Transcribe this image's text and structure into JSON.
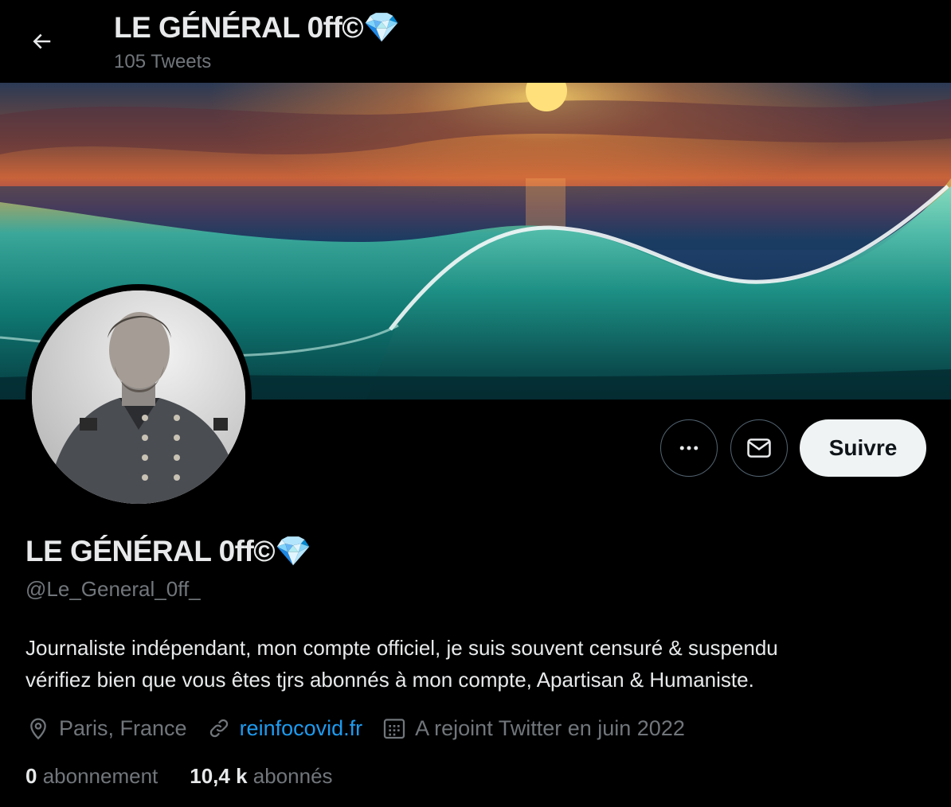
{
  "header": {
    "title": "LE GÉNÉRAL 0ff©💎",
    "tweet_count": "105 Tweets",
    "back_icon": "arrow-left-icon"
  },
  "profile": {
    "display_name": "LE GÉNÉRAL 0ff©💎",
    "handle": "@Le_General_0ff_",
    "bio_lines": [
      "Journaliste indépendant, mon compte officiel, je suis souvent censuré & suspendu",
      "vérifiez bien que vous êtes tjrs abonnés à mon compte, Apartisan & Humaniste."
    ],
    "location": "Paris, France",
    "website": "reinfocovid.fr",
    "joined": "A rejoint Twitter en juin 2022",
    "following_count": "0",
    "following_label": "abonnement",
    "followers_count": "10,4 k",
    "followers_label": "abonnés"
  },
  "actions": {
    "more_icon": "more-icon",
    "message_icon": "envelope-icon",
    "follow_label": "Suivre"
  },
  "colors": {
    "background": "#000000",
    "text_primary": "#e7e9ea",
    "text_secondary": "#71767b",
    "link": "#1d9bf0",
    "follow_bg": "#eff3f4"
  }
}
